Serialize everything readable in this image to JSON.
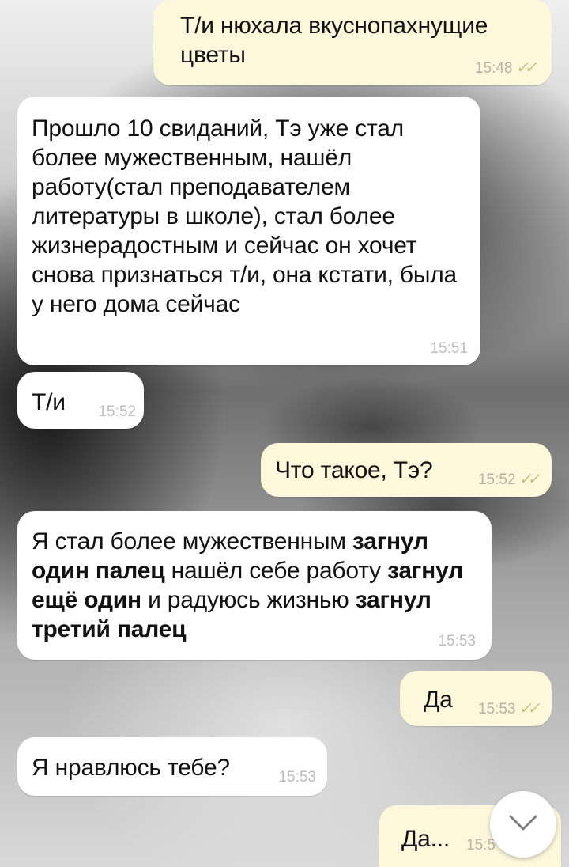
{
  "messages": [
    {
      "id": "m1",
      "dir": "out",
      "text": "Т/и нюхала вкуснопахнущие цветы",
      "time": "15:48",
      "ticks": "✓✓"
    },
    {
      "id": "m2",
      "dir": "in",
      "text": "Прошло 10 свиданий, Тэ уже стал более мужественным, нашёл работу(стал преподавателем литературы в школе), стал более жизнерадостным и сейчас он хочет снова признаться т/и, она кстати, была у него дома сейчас",
      "time": "15:51"
    },
    {
      "id": "m3",
      "dir": "in",
      "text": "Т/и",
      "time": "15:52"
    },
    {
      "id": "m4",
      "dir": "out",
      "text": "Что такое, Тэ?",
      "time": "15:52",
      "ticks": "✓✓"
    },
    {
      "id": "m5",
      "dir": "in",
      "parts": [
        "Я стал более мужественным ",
        "загнул один палец",
        " нашёл себе работу ",
        "загнул ещё один",
        " и радуюсь жизнью ",
        "загнул третий палец"
      ],
      "time": "15:53"
    },
    {
      "id": "m6",
      "dir": "out",
      "text": "Да",
      "time": "15:53",
      "ticks": "✓✓"
    },
    {
      "id": "m7",
      "dir": "in",
      "text": "Я нравлюсь тебе?",
      "time": "15:53"
    },
    {
      "id": "m8",
      "dir": "out",
      "text": "Да...",
      "time": "15:5"
    }
  ],
  "scroll_button": {
    "icon": "chevron-down-icon"
  }
}
